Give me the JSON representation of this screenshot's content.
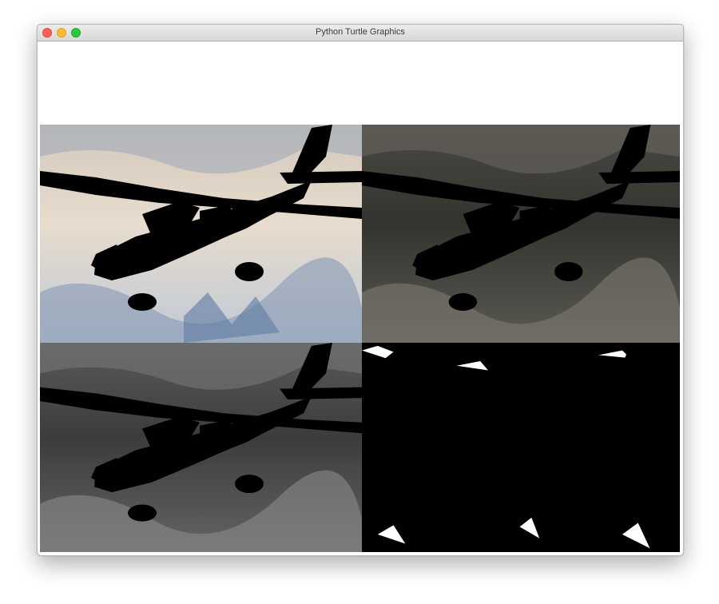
{
  "window": {
    "title": "Python Turtle Graphics"
  },
  "panels": [
    {
      "id": "top-left",
      "filter": "inverted color",
      "icon": "airplane-photo"
    },
    {
      "id": "top-right",
      "filter": "original color",
      "icon": "airplane-photo"
    },
    {
      "id": "bottom-left",
      "filter": "grayscale",
      "icon": "airplane-photo"
    },
    {
      "id": "bottom-right",
      "filter": "black and white threshold",
      "icon": "airplane-photo"
    }
  ],
  "colors": {
    "close": "#fe5f57",
    "minimize": "#febc2e",
    "maximize": "#28c840"
  }
}
